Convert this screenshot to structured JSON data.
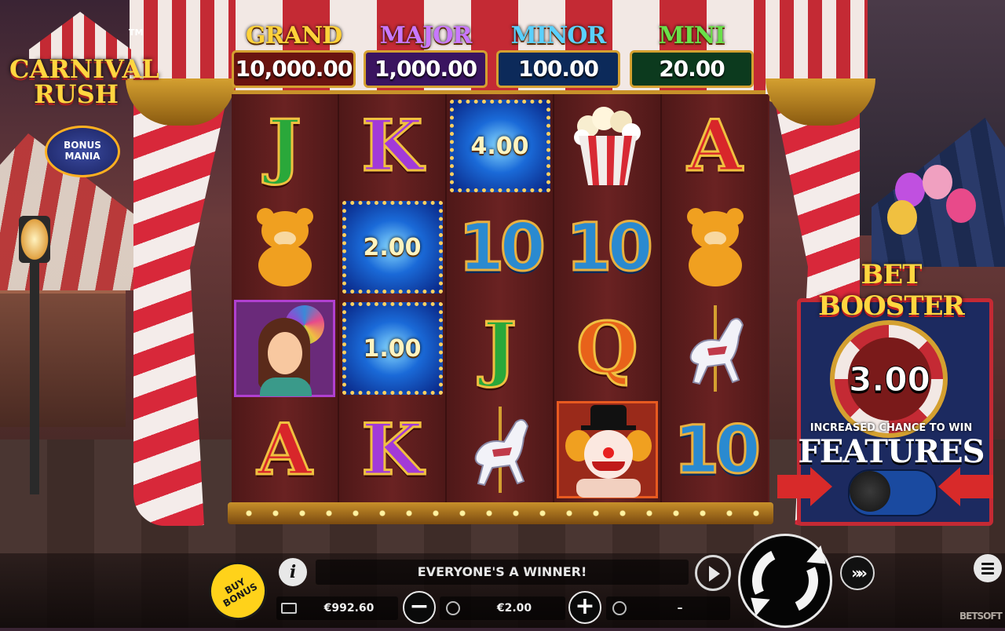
{
  "game": {
    "logo_title_line1": "CARNIVAL",
    "logo_title_line2": "RUSH",
    "logo_trademark": "TM",
    "logo_badge_line1": "BONUS",
    "logo_badge_line2": "MANIA"
  },
  "jackpots": [
    {
      "name": "GRAND",
      "value": "10,000.00",
      "name_color": "#ffd23a",
      "box_color": "#6a1410"
    },
    {
      "name": "MAJOR",
      "value": "1,000.00",
      "name_color": "#c878ff",
      "box_color": "#3a1460"
    },
    {
      "name": "MINOR",
      "value": "100.00",
      "name_color": "#5ad0ff",
      "box_color": "#0c2a5a"
    },
    {
      "name": "MINI",
      "value": "20.00",
      "name_color": "#6ae04a",
      "box_color": "#0c3a1e"
    }
  ],
  "reels": {
    "columns": [
      [
        {
          "type": "letter",
          "symbol": "J",
          "color": "#2aa83a"
        },
        {
          "type": "bear",
          "symbol": "teddy-bear"
        },
        {
          "type": "dancer",
          "symbol": "showgirl"
        },
        {
          "type": "letter",
          "symbol": "A",
          "color": "#d8262a"
        }
      ],
      [
        {
          "type": "letter",
          "symbol": "K",
          "color": "#a23ad8"
        },
        {
          "type": "cash",
          "symbol": "2.00"
        },
        {
          "type": "cash",
          "symbol": "1.00"
        },
        {
          "type": "letter",
          "symbol": "K",
          "color": "#a23ad8"
        }
      ],
      [
        {
          "type": "cash",
          "symbol": "4.00"
        },
        {
          "type": "ten",
          "symbol": "10"
        },
        {
          "type": "letter",
          "symbol": "J",
          "color": "#2aa83a"
        },
        {
          "type": "horse",
          "symbol": "carousel-horse"
        }
      ],
      [
        {
          "type": "popcorn",
          "symbol": "popcorn"
        },
        {
          "type": "ten",
          "symbol": "10"
        },
        {
          "type": "letter",
          "symbol": "Q",
          "color": "#e8621a"
        },
        {
          "type": "clown",
          "symbol": "clown"
        }
      ],
      [
        {
          "type": "letter",
          "symbol": "A",
          "color": "#d8262a"
        },
        {
          "type": "bear",
          "symbol": "teddy-bear"
        },
        {
          "type": "horse",
          "symbol": "carousel-horse"
        },
        {
          "type": "ten",
          "symbol": "10"
        }
      ]
    ]
  },
  "bet_booster": {
    "title": "BET BOOSTER",
    "multiplier": "3.00",
    "subtitle": "INCREASED CHANCE TO WIN",
    "features_label": "FEATURES"
  },
  "controls": {
    "message": "EVERYONE'S A WINNER!",
    "buy_bonus_line1": "BUY",
    "buy_bonus_line2": "BONUS",
    "info_label": "i",
    "balance": "€992.60",
    "bet": "€2.00",
    "win": "–",
    "minus_label": "−",
    "plus_label": "+",
    "turbo_label": "»»",
    "brand": "BETSOFT"
  }
}
